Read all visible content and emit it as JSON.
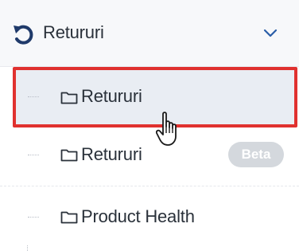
{
  "header": {
    "title": "Retururi",
    "icon": "undo-arrow-icon",
    "chevron": "chevron-down-icon",
    "accent_color": "#1f3a6a"
  },
  "tree": {
    "items": [
      {
        "label": "Retururi",
        "icon": "folder-icon",
        "state": "hovered-selected"
      },
      {
        "label": "Retururi",
        "icon": "folder-icon",
        "badge": "Beta"
      },
      {
        "label": "Product Health",
        "icon": "folder-icon"
      }
    ]
  },
  "colors": {
    "highlight_border": "#e0312f",
    "badge_bg": "#d4d8dd",
    "text": "#2a313a"
  }
}
